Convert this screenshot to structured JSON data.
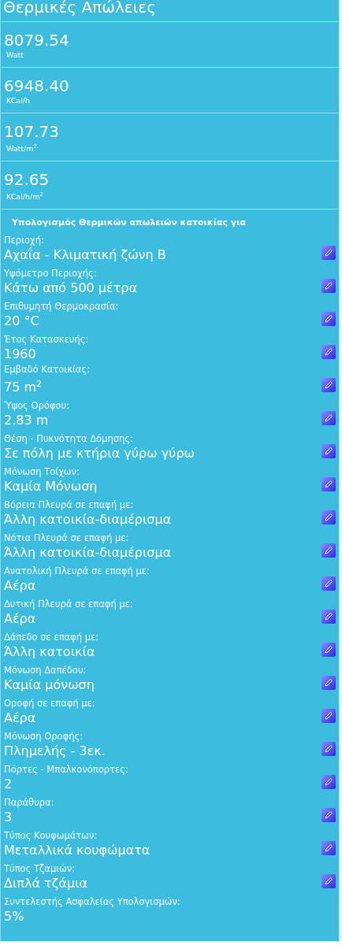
{
  "title": "Θερμικές Απώλειες",
  "metrics": [
    {
      "value": "8079.54",
      "unit": "Watt"
    },
    {
      "value": "6948.40",
      "unit": "KCal/h"
    },
    {
      "value": "107.73",
      "unit": "Watt/m$^{2}$"
    },
    {
      "value": "92.65",
      "unit": "KCal/h/m$^{2}$"
    }
  ],
  "heading": "Υπολογισμός Θερμικών απωλειών κατοικίας για",
  "fields": [
    {
      "label": "Περιοχή:",
      "value": "Αχαΐα - Κλιματική ζώνη Β",
      "editable": true
    },
    {
      "label": "Υψόμετρο Περιοχής:",
      "value": "Κάτω από 500 μέτρα",
      "editable": true
    },
    {
      "label": "Επιθυμητή Θερμοκρασία:",
      "value": "20 °C",
      "editable": true
    },
    {
      "label": "Έτος Κατασκευής:",
      "value": "1960",
      "editable": true
    },
    {
      "label": "Εμβαδό Κατοικίας:",
      "value": "75 m$^{2}$",
      "editable": true
    },
    {
      "label": "Ύψος Ορόφου:",
      "value": "2.83 m",
      "editable": true
    },
    {
      "label": "Θέση - Πυκνότητα Δόμησης:",
      "value": "Σε πόλη με κτήρια γύρω γύρω",
      "editable": true
    },
    {
      "label": "Μόνωση Τοίχων:",
      "value": "Καμία Μόνωση",
      "editable": true
    },
    {
      "label": "Βόρεια Πλευρά σε επαφή με:",
      "value": "Άλλη κατοικία-διαμέρισμα",
      "editable": true
    },
    {
      "label": "Νότια Πλευρά σε επαφή με:",
      "value": "Άλλη κατοικία-διαμέρισμα",
      "editable": true
    },
    {
      "label": "Ανατολική Πλευρά σε επαφή με:",
      "value": "Αέρα",
      "editable": true
    },
    {
      "label": "Δυτική Πλευρά σε επαφή με:",
      "value": "Αέρα",
      "editable": true
    },
    {
      "label": "Δάπεδο σε επαφή με:",
      "value": "Άλλη κατοικία",
      "editable": true
    },
    {
      "label": "Μόνωση Δαπέδου:",
      "value": "Καμία μόνωση",
      "editable": true
    },
    {
      "label": "Οροφή σε επαφή με:",
      "value": "Αέρα",
      "editable": true
    },
    {
      "label": "Μόνωση Οροφής:",
      "value": "Πλημελής - 3εκ.",
      "editable": true
    },
    {
      "label": "Πόρτες - Μπαλκονόπορτες:",
      "value": "2",
      "editable": true
    },
    {
      "label": "Παράθυρα:",
      "value": "3",
      "editable": true
    },
    {
      "label": "Τύπος Κουφωμάτων:",
      "value": "Μεταλλικά κουφώματα",
      "editable": true
    },
    {
      "label": "Τύπος Τζαμιών:",
      "value": "Διπλά τζάμια",
      "editable": true
    },
    {
      "label": "Συντελεστής Ασφαλείας Υπολογισμών:",
      "value": "5%",
      "editable": false
    }
  ]
}
